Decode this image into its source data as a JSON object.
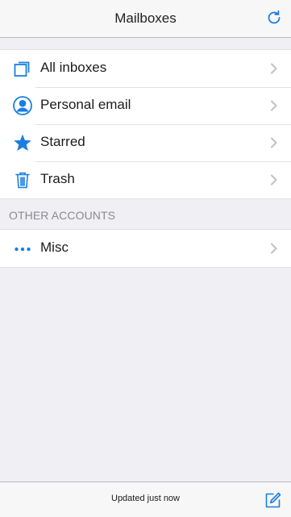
{
  "nav": {
    "title": "Mailboxes",
    "refresh_icon": "refresh-icon"
  },
  "mailboxes": [
    {
      "label": "All inboxes",
      "icon": "inbox-stack-icon"
    },
    {
      "label": "Personal email",
      "icon": "person-icon"
    },
    {
      "label": "Starred",
      "icon": "star-icon"
    },
    {
      "label": "Trash",
      "icon": "trash-icon"
    }
  ],
  "other_accounts": {
    "header": "OTHER ACCOUNTS",
    "items": [
      {
        "label": "Misc",
        "icon": "ellipsis-icon"
      }
    ]
  },
  "toolbar": {
    "status": "Updated just now",
    "compose_icon": "compose-icon"
  },
  "colors": {
    "accent": "#1a7fe0",
    "background": "#efeff4",
    "chevron": "#c4c4c8"
  }
}
